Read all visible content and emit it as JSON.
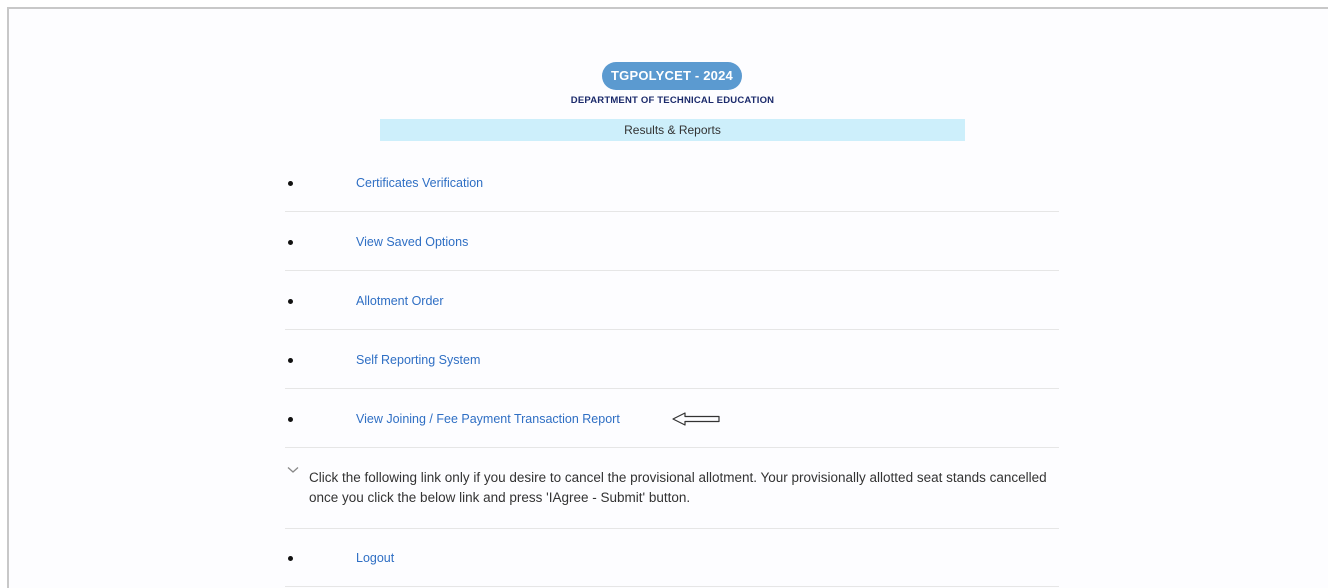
{
  "header": {
    "badge": "TGPOLYCET - 2024",
    "department_prefix": "D",
    "department_rest": "EPARTMENT OF ",
    "department_t": "T",
    "department_echnical": "ECHNICAL ",
    "department_e": "E",
    "department_ducation": "DUCATION",
    "department": "DEPARTMENT OF TECHNICAL EDUCATION",
    "section_title": "Results & Reports"
  },
  "menu": {
    "items": [
      {
        "label": "Certificates Verification"
      },
      {
        "label": "View Saved Options"
      },
      {
        "label": "Allotment Order"
      },
      {
        "label": "Self Reporting System"
      },
      {
        "label": "View Joining / Fee Payment Transaction Report"
      }
    ],
    "notice": "Click the following link only if you desire to cancel the provisional allotment. Your provisionally allotted seat stands cancelled once you click the below link and press 'IAgree - Submit' button.",
    "logout": "Logout"
  },
  "colors": {
    "badge_bg": "#5b9ad0",
    "banner_bg": "#cdeffb",
    "link": "#2f6fc4",
    "department_text": "#1b2a6b"
  },
  "icons": {
    "bullet": "bullet-icon",
    "pointer": "left-arrow-icon",
    "expand": "chevron-down-icon"
  }
}
